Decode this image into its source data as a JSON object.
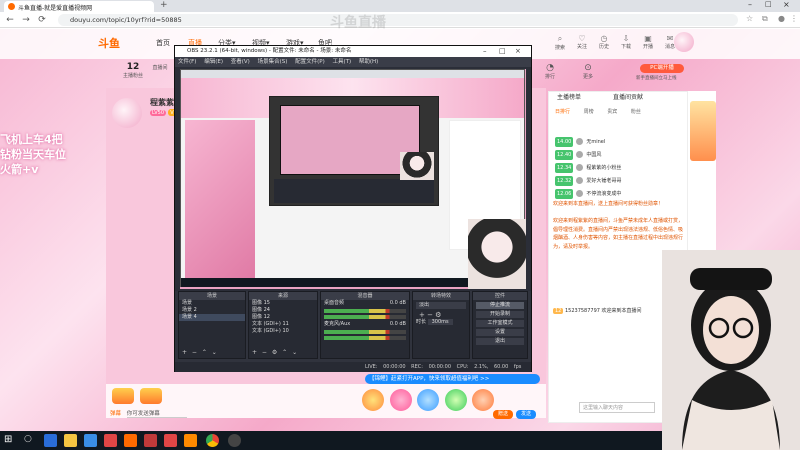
{
  "browser": {
    "tab_title": "斗鱼直播-就是爱直播视频网",
    "url": "douyu.com/topic/10yrf?rid=50885",
    "back": "←",
    "forward": "→",
    "reload": "⟳"
  },
  "watermark": "斗鱼直播",
  "site": {
    "logo": "斗鱼",
    "nav": [
      "首页",
      "直播",
      "分类▾",
      "视频▾",
      "游戏▾",
      "鱼吧"
    ],
    "header_icons": [
      {
        "icon": "search-icon",
        "label": "搜索"
      },
      {
        "icon": "heart-icon",
        "label": "关注"
      },
      {
        "icon": "history-icon",
        "label": "历史"
      },
      {
        "icon": "download-icon",
        "label": "下载"
      },
      {
        "icon": "open-live-icon",
        "label": "开播"
      },
      {
        "icon": "message-icon",
        "label": "消息"
      }
    ],
    "fans_count": "12",
    "fans_label": "主播粉丝",
    "follow_label": "直播间",
    "slogan": [
      "飞机上车4把",
      "钻粉当天车位",
      "火箭+v"
    ],
    "anchor_name": "程紫紫",
    "anchor_level": "LV50",
    "anchor_tag": "V鱼吧",
    "pc_live_label": "PC端开播",
    "pc_live_sub": "新手直播间立马上线",
    "rank_label": "排行",
    "more_label": "更多"
  },
  "obs": {
    "title": "OBS 23.2.1 (64-bit, windows) - 配置文件: 未命名 - 场景: 未命名",
    "menu": [
      "文件(F)",
      "编辑(E)",
      "查看(V)",
      "场景集合(S)",
      "配置文件(P)",
      "工具(T)",
      "帮助(H)"
    ],
    "panels": {
      "scenes": {
        "title": "场景",
        "items": [
          "场景",
          "场景 2",
          "场景 4"
        ]
      },
      "sources": {
        "title": "来源",
        "items": [
          "图像 15",
          "图像 24",
          "图像 12",
          "文本 (GDI+) 11",
          "文本 (GDI+) 10"
        ]
      },
      "mixer": {
        "title": "混音器",
        "items": [
          "桌面音频",
          "麦克风/Aux"
        ],
        "level_1": "0.0 dB",
        "level_2": "0.0 dB"
      },
      "transitions": {
        "title": "转场特效",
        "type": "淡出",
        "duration_label": "时长",
        "duration": "300ms"
      },
      "controls": {
        "title": "控件",
        "buttons": [
          "停止推流",
          "开始录制",
          "工作室模式",
          "设置",
          "退出"
        ]
      }
    },
    "status": [
      "LIVE: 00:00:00",
      "REC: 00:00:00",
      "CPU: 2.1%, 60.00 fps"
    ]
  },
  "chat": {
    "tab_rank": "主播榜单",
    "tab_contrib": "直播间贡献",
    "rank_tabs": [
      "日排行",
      "周榜",
      "贵宾",
      "粉丝"
    ],
    "rank_rows": [
      {
        "lv": "14.00",
        "name": "无minel"
      },
      {
        "lv": "12.40",
        "name": "中国风"
      },
      {
        "lv": "12.34",
        "name": "程紫紫的小粉丝"
      },
      {
        "lv": "12.32",
        "name": "爱好大锤老哥哥"
      },
      {
        "lv": "12.06",
        "name": "不停流浪变成中"
      }
    ],
    "notice": "欢迎来到本直播间，送上直播间可获得粉丝勋章！",
    "notice2": "欢迎来到程紫紫的直播间，斗鱼严禁未成年人直播或打赏，倡导理性消费。直播间内严禁出现违法违规、低俗色情、吸烟酗酒、人身伤害等内容，如主播在直播过程中出现违规行为，请及时举报。",
    "message_level": "12",
    "message_text": "15237587797  欢迎来到本直播间",
    "input_placeholder": "这里输入聊天内容"
  },
  "player": {
    "danmu_placeholder": "你可发送弹幕",
    "danmu_label": "弹幕",
    "send_label": "赠送",
    "send2_label": "发送",
    "overlay_banner": "【锦鲤】赶紧打开APP，快来领取超值福利吧 >>"
  }
}
